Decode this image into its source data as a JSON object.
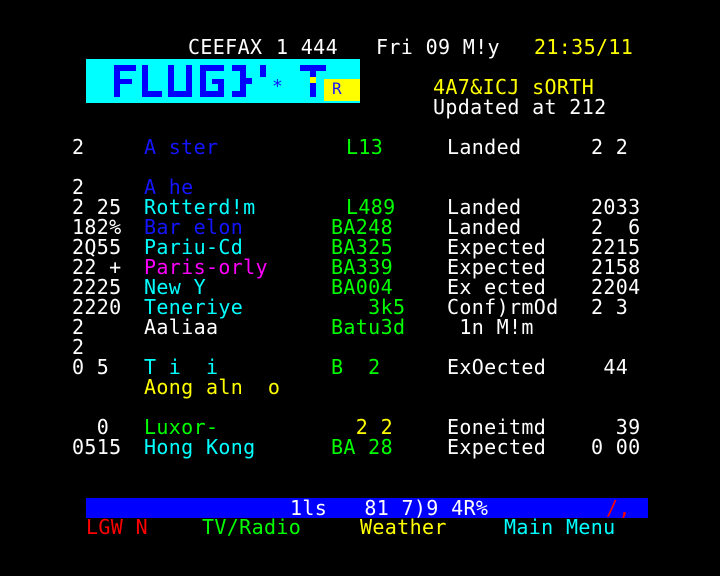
{
  "header": {
    "service": "CEEFAX",
    "page_number": "1 444",
    "date": "Fri 09 M!y",
    "time": "21:35/11"
  },
  "logo": {
    "text": "FLIGHTS",
    "text_as_shown": "FLUG}'T",
    "marks": "*",
    "tag": "R",
    "colors": {
      "background": "#00ffff",
      "letters": "#0000ff",
      "tag": "#ffff00"
    }
  },
  "subheader": {
    "title": "4A7&ICJ sORTH",
    "updated": "Updated at 212"
  },
  "flights": [
    {
      "time": "2",
      "destination": "A ster",
      "dest_color": "blue",
      "flight": "L13",
      "status": "Landed",
      "status_time": "2 2"
    },
    {
      "time": "",
      "destination": "",
      "dest_color": "blue",
      "flight": "",
      "status": "",
      "status_time": ""
    },
    {
      "time": "2",
      "destination": "A he",
      "dest_color": "blue",
      "flight": "",
      "status": "",
      "status_time": ""
    },
    {
      "time": "2 25",
      "destination": "Rotterd!m",
      "dest_color": "cyan",
      "flight": "L489",
      "status": "Landed",
      "status_time": "2033"
    },
    {
      "time": "182%",
      "destination": "Bar elon",
      "dest_color": "blue",
      "flight": "BA248",
      "status": "Landed",
      "status_time": "2  6"
    },
    {
      "time": "2Q55",
      "destination": "Pariu-Cd",
      "dest_color": "cyan",
      "flight": "BA325",
      "status": "Expected",
      "status_time": "2215"
    },
    {
      "time": "22 +",
      "destination": "Paris-orly",
      "dest_color": "magenta",
      "flight": "BA339",
      "status": "Expected",
      "status_time": "2158"
    },
    {
      "time": "2225",
      "destination": "New Y",
      "dest_color": "cyan",
      "flight": "BA004",
      "status": "Ex ected",
      "status_time": "2204"
    },
    {
      "time": "2220",
      "destination": "Teneriye",
      "dest_color": "cyan",
      "flight": "   3k5",
      "status": "Conf)rmOd",
      "status_time": "2 3"
    },
    {
      "time": "2",
      "destination": "Aaliaa",
      "dest_color": "white",
      "flight": "Batu3d",
      "status": " 1n M!m",
      "status_time": ""
    },
    {
      "time": "2",
      "destination": "",
      "dest_color": "white",
      "flight": "",
      "status": "",
      "status_time": ""
    },
    {
      "time": "0 5",
      "destination": "T i  i",
      "dest_color": "cyan",
      "flight": "B  2",
      "status": "ExOected",
      "status_time": " 44"
    },
    {
      "time": "",
      "destination": "Aong aln  o",
      "dest_color": "yellow",
      "flight": "",
      "status": "",
      "status_time": ""
    },
    {
      "time": "",
      "destination": "",
      "dest_color": "white",
      "flight": "",
      "status": "",
      "status_time": ""
    },
    {
      "time": "  0",
      "destination": "Luxor-",
      "dest_color": "green",
      "flight": "  2 2",
      "status": "Eoneitmd",
      "status_time": "  39"
    },
    {
      "time": "0515",
      "destination": "Hong Kong",
      "dest_color": "cyan",
      "flight": "BA 28",
      "status": "Expected",
      "status_time": "0 00"
    }
  ],
  "banner": {
    "text": "1ls   81 7)9 4R%",
    "tail": "/,"
  },
  "fastext": {
    "red": "LGW N",
    "green": "TV/Radio",
    "yellow": "Weather",
    "cyan": "Main Menu"
  }
}
